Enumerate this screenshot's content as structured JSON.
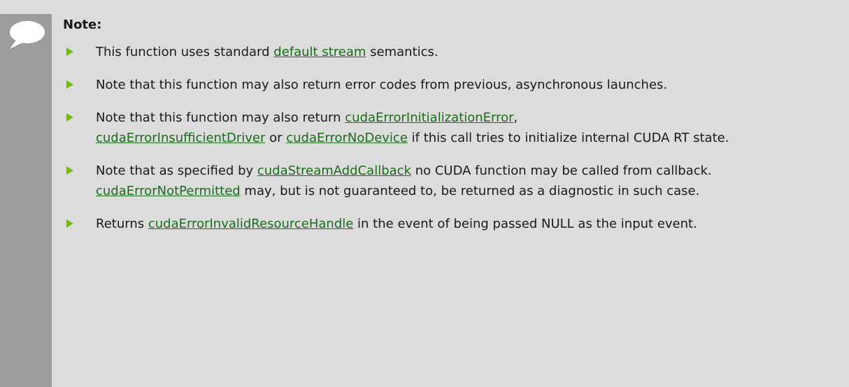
{
  "note": {
    "title": "Note:",
    "items": [
      {
        "parts": [
          {
            "text": "This function uses standard "
          },
          {
            "link": "default stream"
          },
          {
            "text": " semantics."
          }
        ]
      },
      {
        "parts": [
          {
            "text": "Note that this function may also return error codes from previous, asynchronous launches."
          }
        ]
      },
      {
        "parts": [
          {
            "text": "Note that this function may also return "
          },
          {
            "link": "cudaErrorInitializationError"
          },
          {
            "text": ", "
          },
          {
            "link": "cudaErrorInsufficientDriver"
          },
          {
            "text": " or "
          },
          {
            "link": "cudaErrorNoDevice"
          },
          {
            "text": " if this call tries to initialize internal CUDA RT state."
          }
        ]
      },
      {
        "parts": [
          {
            "text": "Note that as specified by "
          },
          {
            "link": "cudaStreamAddCallback"
          },
          {
            "text": " no CUDA function may be called from callback. "
          },
          {
            "link": "cudaErrorNotPermitted"
          },
          {
            "text": " may, but is not guaranteed to, be returned as a diagnostic in such case."
          }
        ]
      },
      {
        "parts": [
          {
            "text": "Returns "
          },
          {
            "link": "cudaErrorInvalidResourceHandle"
          },
          {
            "text": " in the event of being passed NULL as the input event."
          }
        ]
      }
    ]
  },
  "colors": {
    "background": "#dcdcdc",
    "sidebar": "#9c9c9c",
    "bullet": "#76b900",
    "link": "#1a6b1a"
  },
  "icons": {
    "note_icon": "speech-bubble-icon",
    "bullet_icon": "triangle-bullet-icon"
  }
}
